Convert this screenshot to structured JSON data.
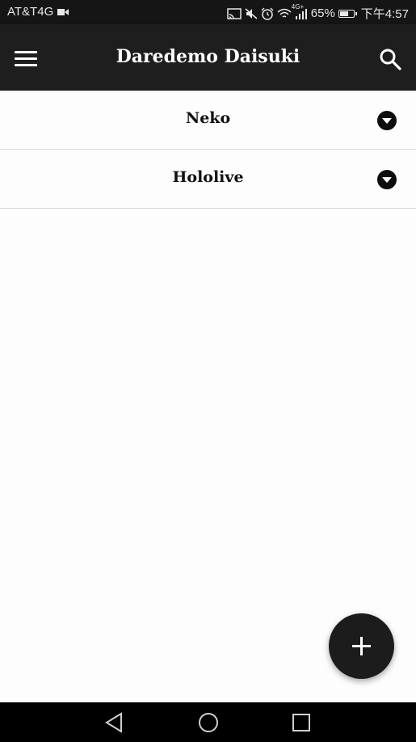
{
  "status_bar": {
    "carrier": "AT&T4G",
    "signal_label": "4G+",
    "battery_percent": "65%",
    "battery_level": 0.65,
    "time": "下午4:57",
    "icons": [
      "video-icon",
      "cast-icon",
      "mute-icon",
      "alarm-icon",
      "wifi-icon",
      "signal-icon",
      "battery-icon"
    ]
  },
  "app_bar": {
    "title": "Daredemo Daisuki",
    "menu_icon": "menu-icon",
    "search_icon": "search-icon"
  },
  "list": {
    "items": [
      {
        "label": "Neko",
        "icon": "dropdown-icon"
      },
      {
        "label": "Hololive",
        "icon": "dropdown-icon"
      }
    ]
  },
  "fab": {
    "icon": "plus-icon"
  },
  "nav_bar": {
    "icons": [
      "back-icon",
      "home-icon",
      "recents-icon"
    ]
  },
  "colors": {
    "status_bar_bg": "#151515",
    "app_bar_bg": "#1e1e1e",
    "page_bg": "#fdfdfd",
    "fab_bg": "#1c1c1c",
    "nav_bg": "#000000"
  }
}
